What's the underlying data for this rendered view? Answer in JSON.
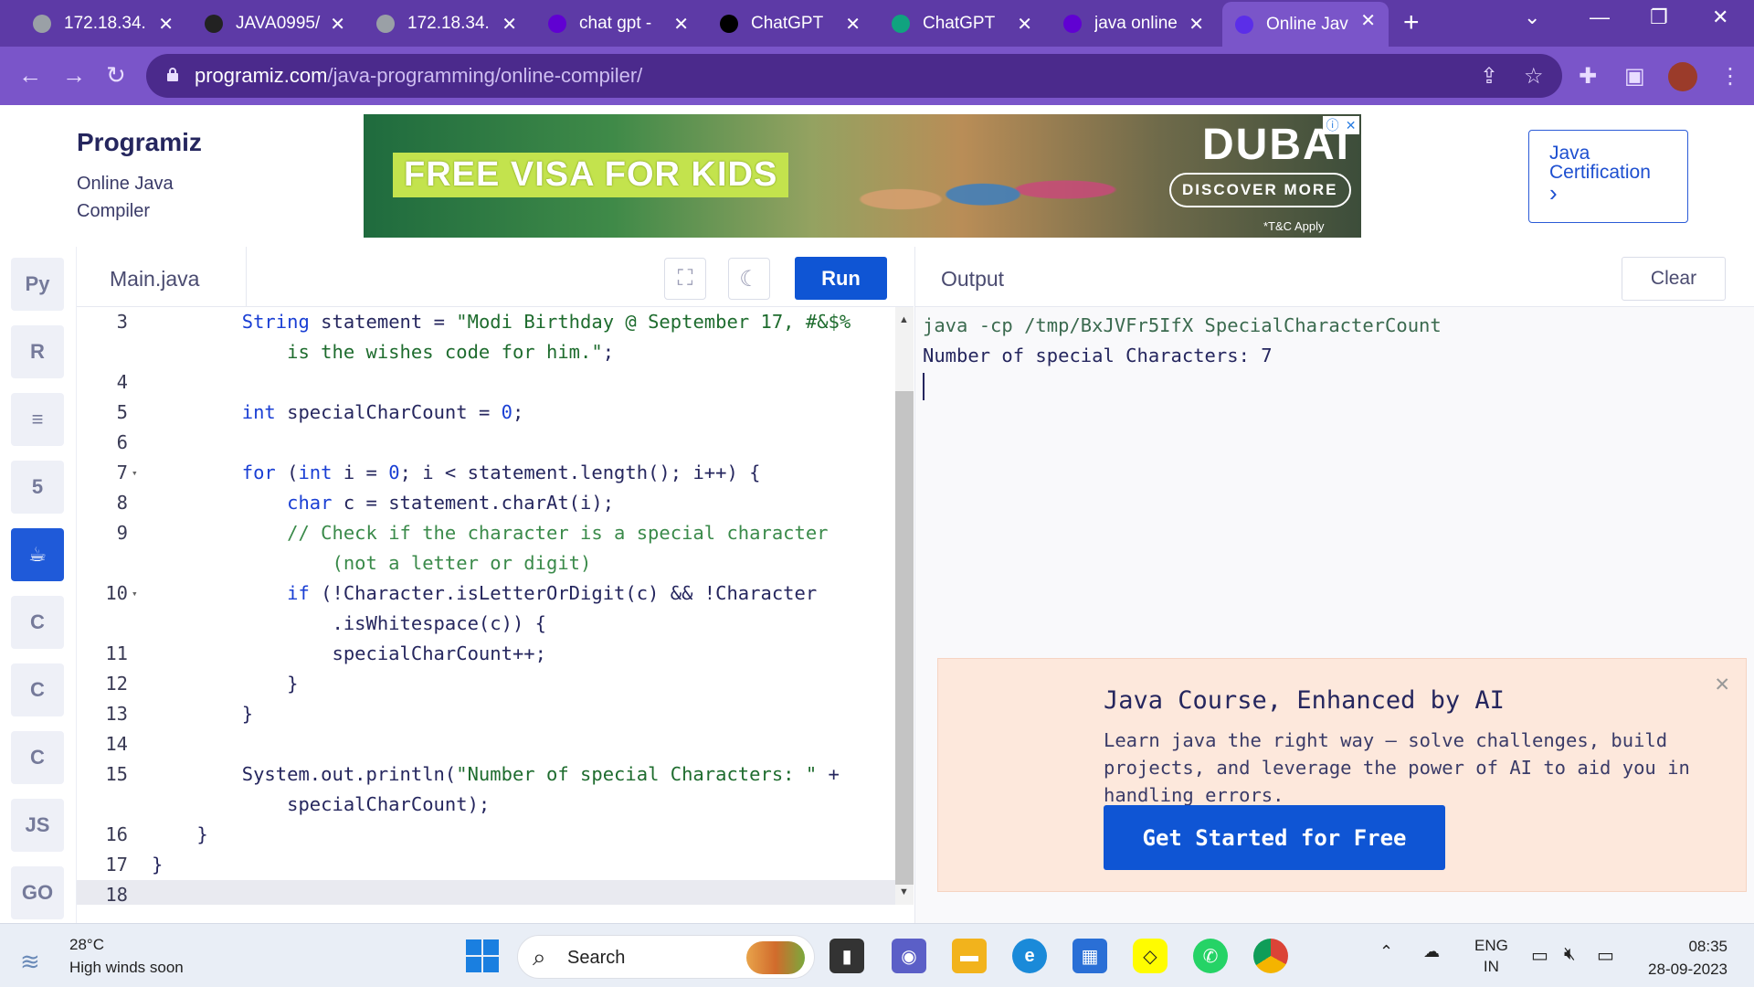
{
  "browser": {
    "tabs": [
      {
        "title": "172.18.34.",
        "icon": "globe-icon",
        "color": "#9aa0a6"
      },
      {
        "title": "JAVA0995/",
        "icon": "github-icon",
        "color": "#222222"
      },
      {
        "title": "172.18.34.",
        "icon": "globe-icon",
        "color": "#9aa0a6"
      },
      {
        "title": "chat gpt -",
        "icon": "yahoo-icon",
        "color": "#6001d2"
      },
      {
        "title": "ChatGPT",
        "icon": "openai-icon",
        "color": "#000000"
      },
      {
        "title": "ChatGPT",
        "icon": "openai-icon",
        "color": "#10a37f"
      },
      {
        "title": "java online",
        "icon": "yahoo-icon",
        "color": "#6001d2"
      },
      {
        "title": "Online Jav",
        "icon": "programiz-icon",
        "color": "#5b2ee8",
        "active": true
      }
    ],
    "url_host": "programiz.com",
    "url_path": "/java-programming/online-compiler/"
  },
  "header": {
    "logo": "Programiz",
    "subtitle": "Online Java Compiler",
    "ad_headline": "FREE VISA FOR KIDS",
    "ad_brand": "DUBAI",
    "ad_cta": "DISCOVER MORE",
    "ad_terms": "*T&C Apply",
    "cert_label": "Java Certification",
    "cert_arrow": "›"
  },
  "sidebar": {
    "languages": [
      {
        "name": "python",
        "glyph": "Py"
      },
      {
        "name": "r",
        "glyph": "R"
      },
      {
        "name": "sql",
        "glyph": "≡"
      },
      {
        "name": "html",
        "glyph": "5"
      },
      {
        "name": "java",
        "glyph": "☕",
        "active": true
      },
      {
        "name": "c",
        "glyph": "C"
      },
      {
        "name": "cpp",
        "glyph": "C"
      },
      {
        "name": "csharp",
        "glyph": "C"
      },
      {
        "name": "js",
        "glyph": "JS"
      },
      {
        "name": "go",
        "glyph": "GO"
      }
    ]
  },
  "editor": {
    "filename": "Main.java",
    "run_label": "Run",
    "lines": [
      {
        "n": "3",
        "segs": [
          [
            "",
            "        "
          ],
          [
            "kw",
            "String"
          ],
          [
            "",
            " statement = "
          ],
          [
            "str",
            "\"Modi Birthday @ September 17, #&$%"
          ]
        ]
      },
      {
        "n": "",
        "segs": [
          [
            "str",
            "            is the wishes code for him.\""
          ],
          [
            "",
            ";"
          ]
        ]
      },
      {
        "n": "4",
        "segs": []
      },
      {
        "n": "5",
        "segs": [
          [
            "",
            "        "
          ],
          [
            "kw",
            "int"
          ],
          [
            "",
            " specialCharCount = "
          ],
          [
            "num",
            "0"
          ],
          [
            "",
            ";"
          ]
        ]
      },
      {
        "n": "6",
        "segs": []
      },
      {
        "n": "7",
        "fold": true,
        "segs": [
          [
            "",
            "        "
          ],
          [
            "kw",
            "for"
          ],
          [
            "",
            " ("
          ],
          [
            "kw",
            "int"
          ],
          [
            "",
            " i = "
          ],
          [
            "num",
            "0"
          ],
          [
            "",
            "; i < statement.length(); i++) {"
          ]
        ]
      },
      {
        "n": "8",
        "segs": [
          [
            "",
            "            "
          ],
          [
            "kw",
            "char"
          ],
          [
            "",
            " c = statement.charAt(i);"
          ]
        ]
      },
      {
        "n": "9",
        "segs": [
          [
            "",
            "            "
          ],
          [
            "cmt",
            "// Check if the character is a special character"
          ]
        ]
      },
      {
        "n": "",
        "segs": [
          [
            "cmt",
            "                (not a letter or digit)"
          ]
        ]
      },
      {
        "n": "10",
        "fold": true,
        "segs": [
          [
            "",
            "            "
          ],
          [
            "kw",
            "if"
          ],
          [
            "",
            " (!Character.isLetterOrDigit(c) && !Character"
          ]
        ]
      },
      {
        "n": "",
        "segs": [
          [
            "",
            "                .isWhitespace(c)) {"
          ]
        ]
      },
      {
        "n": "11",
        "segs": [
          [
            "",
            "                specialCharCount++;"
          ]
        ]
      },
      {
        "n": "12",
        "segs": [
          [
            "",
            "            }"
          ]
        ]
      },
      {
        "n": "13",
        "segs": [
          [
            "",
            "        }"
          ]
        ]
      },
      {
        "n": "14",
        "segs": []
      },
      {
        "n": "15",
        "segs": [
          [
            "",
            "        System.out.println("
          ],
          [
            "str",
            "\"Number of special Characters: \""
          ],
          [
            "",
            " +"
          ]
        ]
      },
      {
        "n": "",
        "segs": [
          [
            "",
            "            specialCharCount);"
          ]
        ]
      },
      {
        "n": "16",
        "segs": [
          [
            "",
            "    }"
          ]
        ]
      },
      {
        "n": "17",
        "segs": [
          [
            "",
            "}"
          ]
        ]
      },
      {
        "n": "18",
        "current": true,
        "segs": []
      }
    ]
  },
  "output": {
    "title": "Output",
    "clear_label": "Clear",
    "command": "java -cp /tmp/BxJVFr5IfX SpecialCharacterCount",
    "result": "Number of special Characters: 7",
    "promo": {
      "title": "Java Course, Enhanced by AI",
      "description": "Learn java the right way – solve challenges, build projects, and leverage the power of AI to aid you in handling errors.",
      "cta": "Get Started for Free"
    }
  },
  "taskbar": {
    "temperature": "28°C",
    "weather": "High winds soon",
    "search": "Search",
    "language": "ENG",
    "region": "IN",
    "time": "08:35",
    "date": "28-09-2023"
  }
}
